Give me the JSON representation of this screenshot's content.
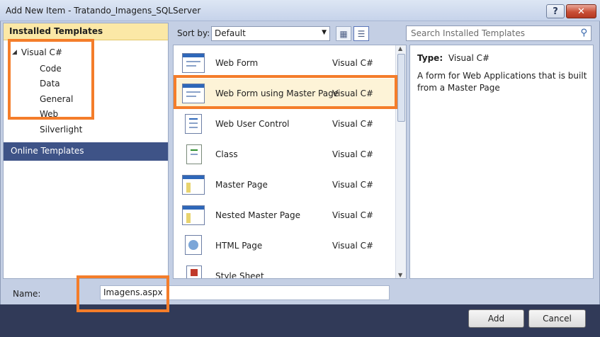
{
  "window": {
    "title": "Add New Item - Tratando_Imagens_SQLServer",
    "help_label": "?",
    "close_label": "✕"
  },
  "left": {
    "installed_header": "Installed Templates",
    "root": "Visual C#",
    "children": [
      "Code",
      "Data",
      "General",
      "Web",
      "Silverlight"
    ],
    "online": "Online Templates"
  },
  "toolbar": {
    "sort_label": "Sort by:",
    "sort_value": "Default",
    "search_placeholder": "Search Installed Templates"
  },
  "templates": [
    {
      "name": "Web Form",
      "lang": "Visual C#",
      "icon": "web-form-icon"
    },
    {
      "name": "Web Form using Master Page",
      "lang": "Visual C#",
      "icon": "web-form-master-icon"
    },
    {
      "name": "Web User Control",
      "lang": "Visual C#",
      "icon": "user-control-icon"
    },
    {
      "name": "Class",
      "lang": "Visual C#",
      "icon": "class-icon"
    },
    {
      "name": "Master Page",
      "lang": "Visual C#",
      "icon": "master-page-icon"
    },
    {
      "name": "Nested Master Page",
      "lang": "Visual C#",
      "icon": "nested-master-page-icon"
    },
    {
      "name": "HTML Page",
      "lang": "Visual C#",
      "icon": "html-page-icon"
    },
    {
      "name": "Style Sheet",
      "lang": "",
      "icon": "style-sheet-icon"
    }
  ],
  "details": {
    "type_label": "Type:",
    "type_value": "Visual C#",
    "description": "A form for Web Applications that is built from a Master Page"
  },
  "name_row": {
    "label": "Name:",
    "value": "Imagens.aspx"
  },
  "buttons": {
    "add": "Add",
    "cancel": "Cancel"
  },
  "colors": {
    "highlight": "#f47d2a",
    "selected_header": "#fbe8a6",
    "online_bg": "#3e5387",
    "bottom_bar": "#313a58"
  }
}
